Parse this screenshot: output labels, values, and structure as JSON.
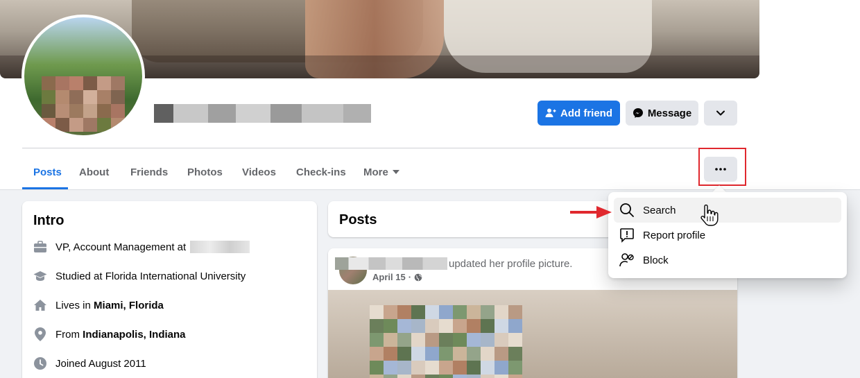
{
  "profile": {
    "name_redacted": true
  },
  "actions": {
    "add_friend": "Add friend",
    "message": "Message",
    "more_menu": "chevron-down-icon"
  },
  "tabs": [
    {
      "label": "Posts",
      "active": true
    },
    {
      "label": "About"
    },
    {
      "label": "Friends"
    },
    {
      "label": "Photos"
    },
    {
      "label": "Videos"
    },
    {
      "label": "Check-ins"
    },
    {
      "label": "More"
    }
  ],
  "dropdown": {
    "items": [
      {
        "label": "Search",
        "icon": "search-icon",
        "hovered": true
      },
      {
        "label": "Report profile",
        "icon": "report-icon"
      },
      {
        "label": "Block",
        "icon": "block-user-icon"
      }
    ]
  },
  "intro": {
    "title": "Intro",
    "rows": [
      {
        "icon": "briefcase-icon",
        "prefix": "VP, Account Management at",
        "bold": ""
      },
      {
        "icon": "graduation-cap-icon",
        "prefix": "Studied at Florida International University",
        "bold": ""
      },
      {
        "icon": "home-icon",
        "prefix": "Lives in ",
        "bold": "Miami, Florida"
      },
      {
        "icon": "location-pin-icon",
        "prefix": "From ",
        "bold": "Indianapolis, Indiana"
      },
      {
        "icon": "clock-icon",
        "prefix": "Joined August 2011",
        "bold": ""
      }
    ]
  },
  "posts": {
    "title": "Posts",
    "post": {
      "action_text": "updated her profile picture.",
      "date": "April 15",
      "privacy_icon": "globe-icon"
    }
  },
  "colors": {
    "accent": "#1b74e4",
    "highlight": "#e0282e",
    "background": "#f0f2f5"
  }
}
